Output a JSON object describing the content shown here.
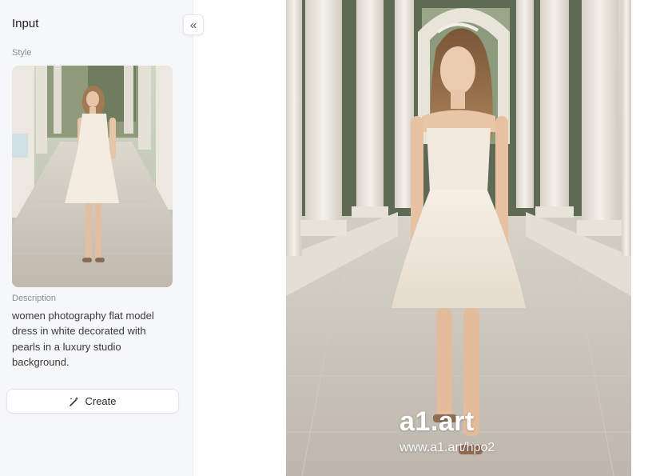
{
  "panel": {
    "title": "Input",
    "collapse_icon": "«",
    "style_label": "Style",
    "description_label": "Description",
    "description": "women photography flat model dress in white decorated with pearls in a luxury studio background.",
    "create_label": "Create"
  },
  "result": {
    "watermark_logo": "a1.art",
    "watermark_url": "www.a1.art/hpo2"
  },
  "colors": {
    "panel_bg": "#f6f7f8",
    "dress": "#f3ece0",
    "marble": "#e9e4da"
  }
}
